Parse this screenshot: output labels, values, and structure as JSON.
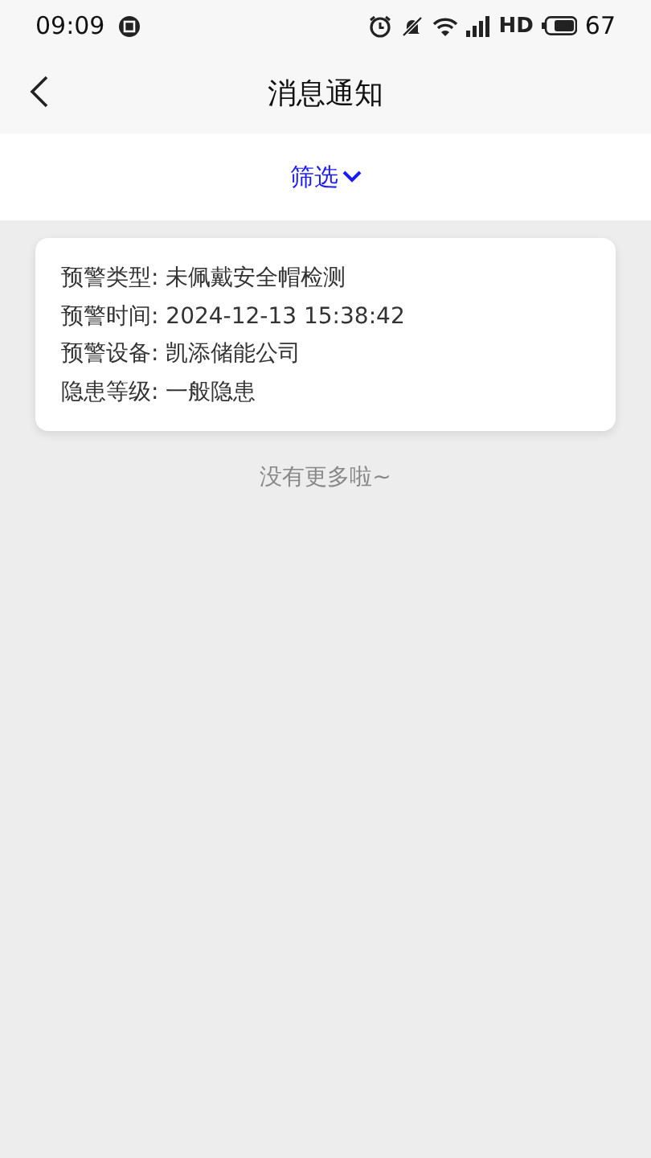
{
  "status_bar": {
    "time": "09:09",
    "network": "HD",
    "battery": "67"
  },
  "header": {
    "title": "消息通知"
  },
  "filter": {
    "label": "筛选"
  },
  "messages": [
    {
      "lines": [
        "预警类型: 未佩戴安全帽检测",
        "预警时间: 2024-12-13 15:38:42",
        "预警设备: 凯添储能公司",
        "隐患等级: 一般隐患"
      ]
    }
  ],
  "footer": "没有更多啦~"
}
